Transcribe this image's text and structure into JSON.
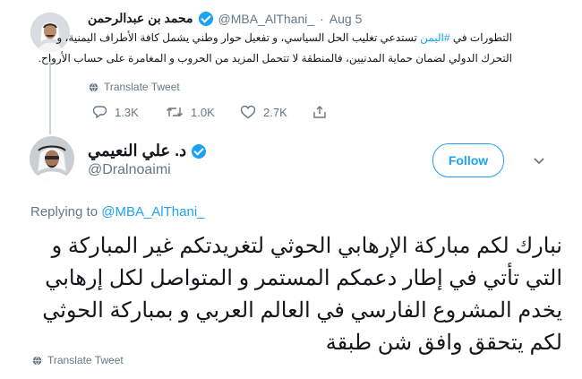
{
  "quoted_tweet": {
    "display_name": "محمد بن عبدالرحمن",
    "handle": "@MBA_AlThani_",
    "separator": "·",
    "date": "Aug 5",
    "text_line1_before": "التطورات في ",
    "text_line1_hashtag": "#اليمن",
    "text_line1_after": " تستدعي تغليب الحل السياسي، و تفعيل حوار وطني يشمل كافة الأطراف اليمنية، و",
    "text_line2": "التحرك الدولي لضمان حماية المدنيين، فالمنطقة لا تتحمل المزيد من الحروب و المغامرة على حساب الأرواح.",
    "translate_label": "Translate Tweet",
    "replies": "1.3K",
    "retweets": "1.0K",
    "likes": "2.7K"
  },
  "reply_tweet": {
    "display_name": "د. علي النعيمي",
    "handle": "@Dralnoaimi",
    "follow_label": "Follow",
    "replying_to_label": "Replying to",
    "replying_to_handle": "@MBA_AlThani_",
    "text_lines": [
      "نبارك لكم مباركة الإرهابي الحوثي لتغريدتكم غير المباركة و",
      "التي تأتي في إطار دعمكم المستمر و المتواصل لكل إرهابي",
      "يخدم المشروع الفارسي في العالم العربي و بمباركة الحوثي",
      "لكم يتحقق وافق شن طبقة"
    ],
    "translate_label": "Translate Tweet"
  },
  "colors": {
    "accent": "#1da1f2",
    "secondary_text": "#657786",
    "thread_line": "#ccd6dd"
  },
  "icons": [
    "verified-badge-icon",
    "globe-icon",
    "reply-icon",
    "retweet-icon",
    "like-icon",
    "share-icon",
    "chevron-down-icon"
  ]
}
